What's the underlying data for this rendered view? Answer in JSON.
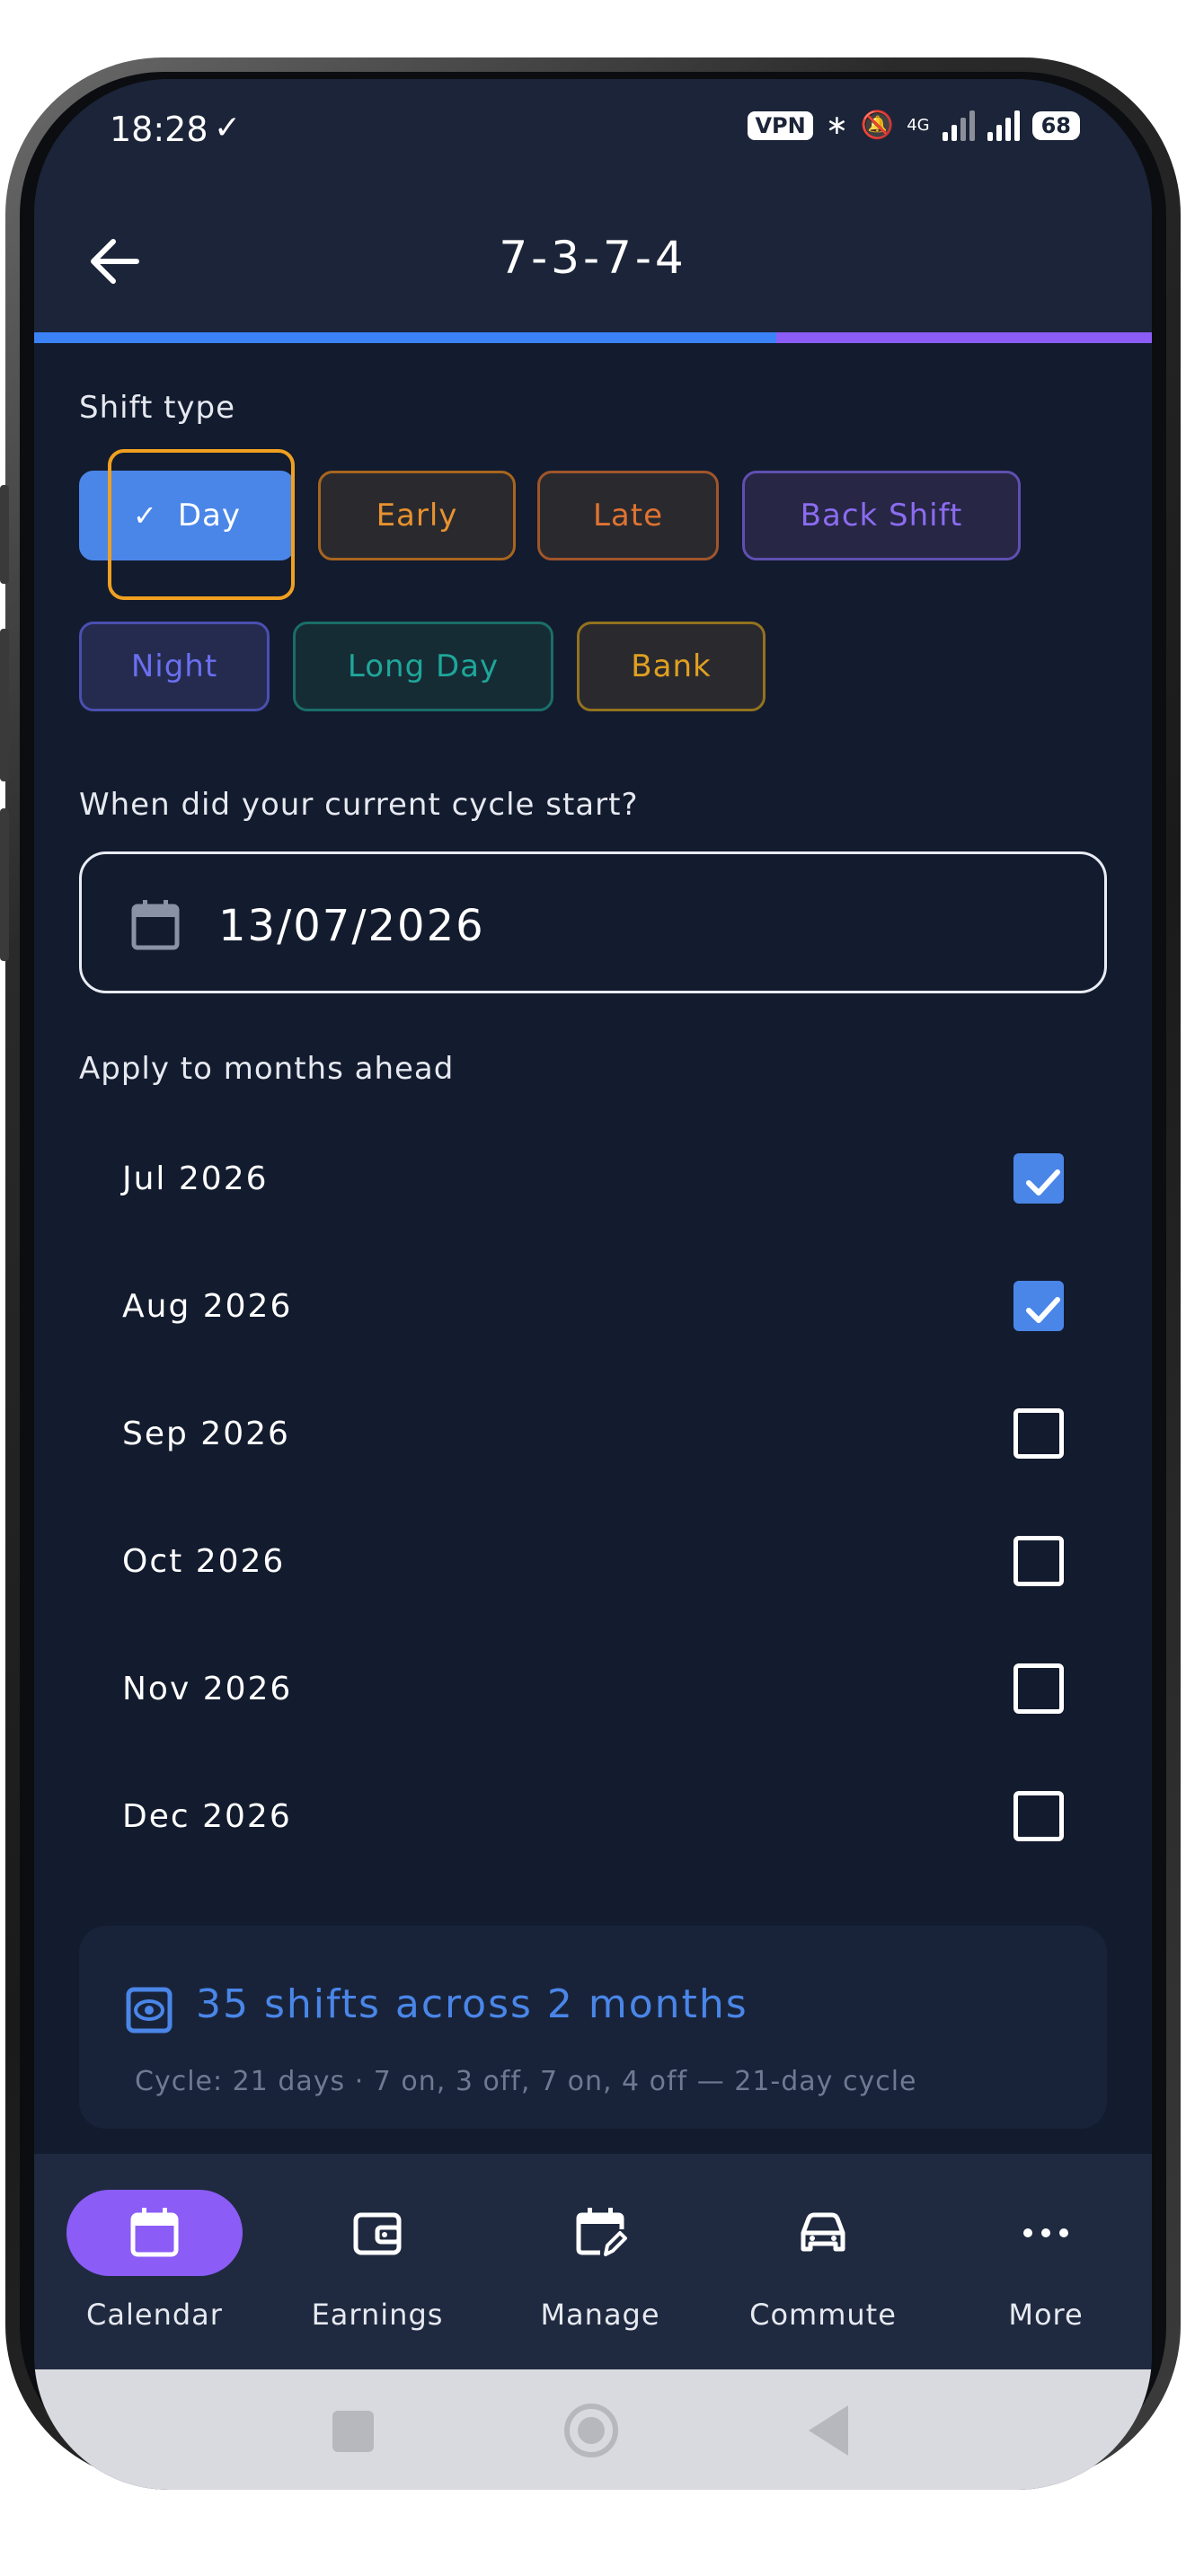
{
  "status_bar": {
    "time": "18:28",
    "vpn": "VPN",
    "network": "4G",
    "battery": "68"
  },
  "header": {
    "title": "7-3-7-4",
    "back_icon": "arrow-left-icon"
  },
  "shift_type": {
    "label": "Shift type",
    "chips": [
      {
        "label": "Day",
        "color": "#4a86e8",
        "selected": true
      },
      {
        "label": "Early",
        "color": "#e8922f",
        "selected": false
      },
      {
        "label": "Late",
        "color": "#e07332",
        "selected": false
      },
      {
        "label": "Back Shift",
        "color": "#8b6cf0",
        "selected": false
      },
      {
        "label": "Night",
        "color": "#6a6ff0",
        "selected": false
      },
      {
        "label": "Long Day",
        "color": "#1ea79a",
        "selected": false
      },
      {
        "label": "Bank",
        "color": "#e0a020",
        "selected": false
      }
    ]
  },
  "cycle_start": {
    "label": "When did your current cycle start?",
    "value": "13/07/2026",
    "icon": "calendar-icon"
  },
  "months": {
    "label": "Apply to months ahead",
    "items": [
      {
        "label": "Jul 2026",
        "checked": true
      },
      {
        "label": "Aug 2026",
        "checked": true
      },
      {
        "label": "Sep 2026",
        "checked": false
      },
      {
        "label": "Oct 2026",
        "checked": false
      },
      {
        "label": "Nov 2026",
        "checked": false
      },
      {
        "label": "Dec 2026",
        "checked": false
      }
    ]
  },
  "summary": {
    "headline": "35 shifts across 2 months",
    "detail": "Cycle: 21 days · 7 on, 3 off, 7 on, 4 off — 21-day cycle",
    "icon": "eye-icon"
  },
  "bottom_nav": {
    "items": [
      {
        "label": "Calendar",
        "icon": "calendar-icon",
        "active": true
      },
      {
        "label": "Earnings",
        "icon": "wallet-icon",
        "active": false
      },
      {
        "label": "Manage",
        "icon": "calendar-edit-icon",
        "active": false
      },
      {
        "label": "Commute",
        "icon": "car-icon",
        "active": false
      },
      {
        "label": "More",
        "icon": "more-dots-icon",
        "active": false
      }
    ]
  },
  "colors": {
    "background": "#131b2e",
    "accent": "#4a86e8",
    "secondary_accent": "#8b5cf6"
  }
}
